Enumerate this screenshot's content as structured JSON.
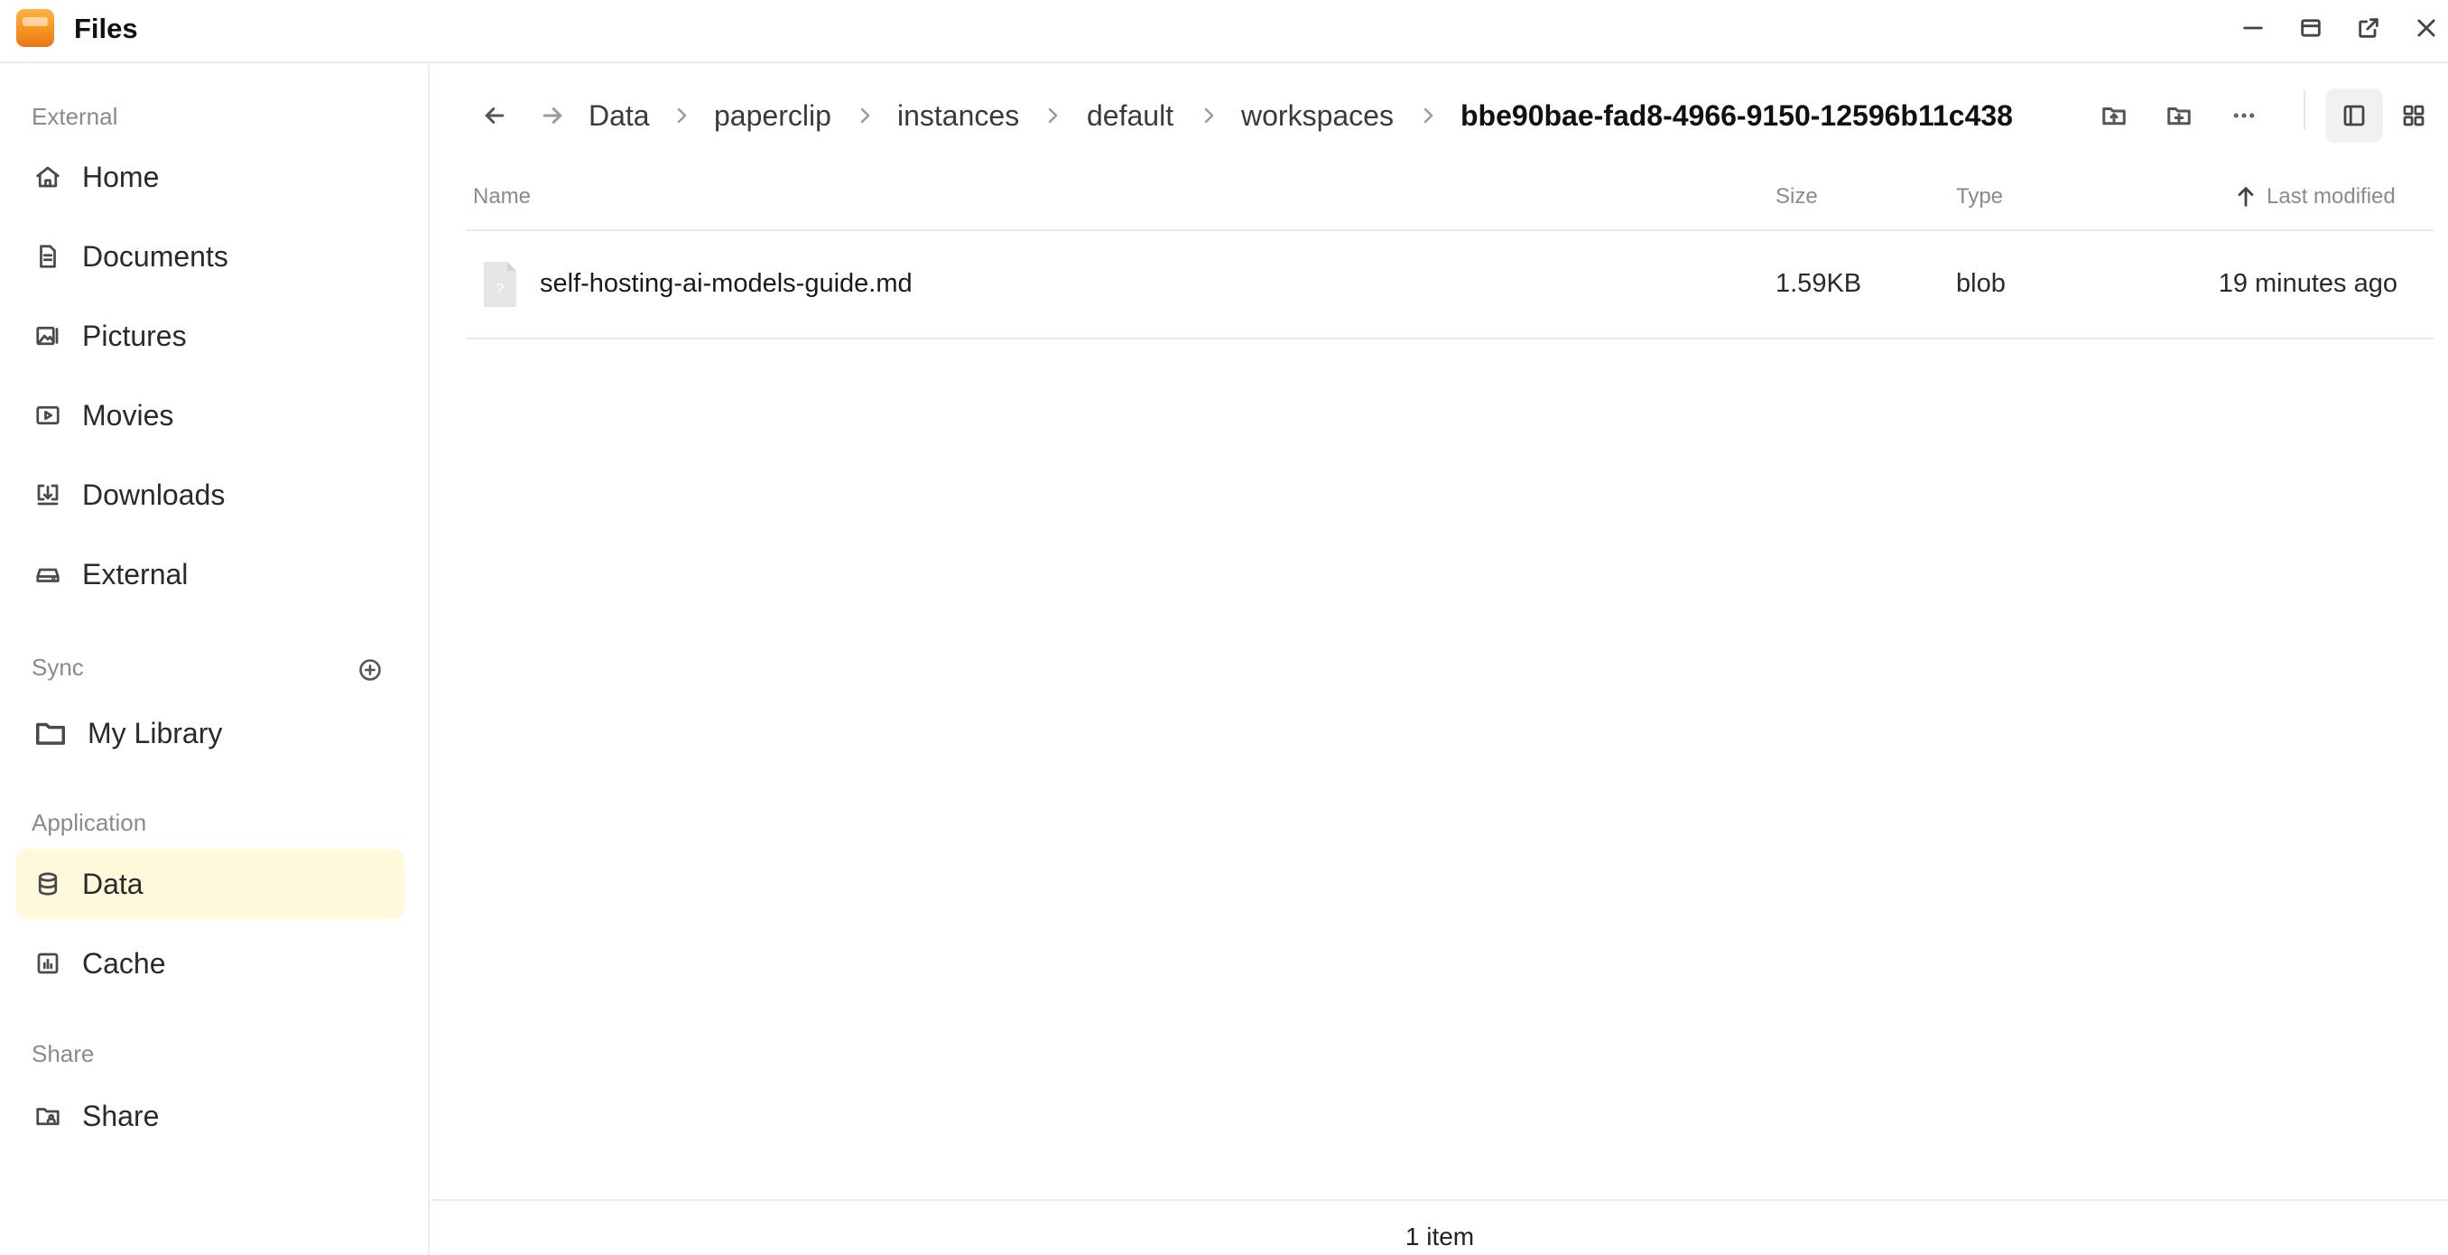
{
  "app": {
    "title": "Files",
    "logo_icon": "files-app-logo"
  },
  "window_controls": [
    "minimize-icon",
    "maximize-icon",
    "popout-icon",
    "close-icon"
  ],
  "sidebar": {
    "external": {
      "label": "External",
      "items": [
        {
          "label": "Home",
          "icon": "home-icon"
        },
        {
          "label": "Documents",
          "icon": "document-icon"
        },
        {
          "label": "Pictures",
          "icon": "pictures-icon"
        },
        {
          "label": "Movies",
          "icon": "movie-icon"
        },
        {
          "label": "Downloads",
          "icon": "download-icon"
        },
        {
          "label": "External",
          "icon": "drive-icon"
        }
      ]
    },
    "sync": {
      "label": "Sync",
      "add_icon": "add-circle-icon",
      "items": [
        {
          "label": "My Library",
          "icon": "folder-icon"
        }
      ]
    },
    "application": {
      "label": "Application",
      "items": [
        {
          "label": "Data",
          "icon": "database-icon",
          "active": true
        },
        {
          "label": "Cache",
          "icon": "cache-icon"
        }
      ]
    },
    "share": {
      "label": "Share",
      "items": [
        {
          "label": "Share",
          "icon": "share-folder-icon"
        }
      ]
    },
    "active_color": "#fff9dc"
  },
  "breadcrumb": {
    "items": [
      "Data",
      "paperclip",
      "instances",
      "default",
      "workspaces"
    ],
    "current": "bbe90bae-fad8-4966-9150-12596b11c438"
  },
  "toolbar": {
    "icons": [
      "back-arrow-icon",
      "forward-arrow-icon",
      "upload-folder-icon",
      "new-folder-icon",
      "more-icon",
      "list-view-icon",
      "grid-view-icon"
    ]
  },
  "table": {
    "columns": {
      "name": "Name",
      "size": "Size",
      "type": "Type",
      "modified": "Last modified"
    },
    "sort": {
      "column": "modified",
      "direction": "ascending"
    },
    "rows": [
      {
        "name": "self-hosting-ai-models-guide.md",
        "size": "1.59KB",
        "type": "blob",
        "modified": "19 minutes ago",
        "icon": "unknown-file-icon"
      }
    ]
  },
  "status": {
    "count_text": "1 item"
  }
}
